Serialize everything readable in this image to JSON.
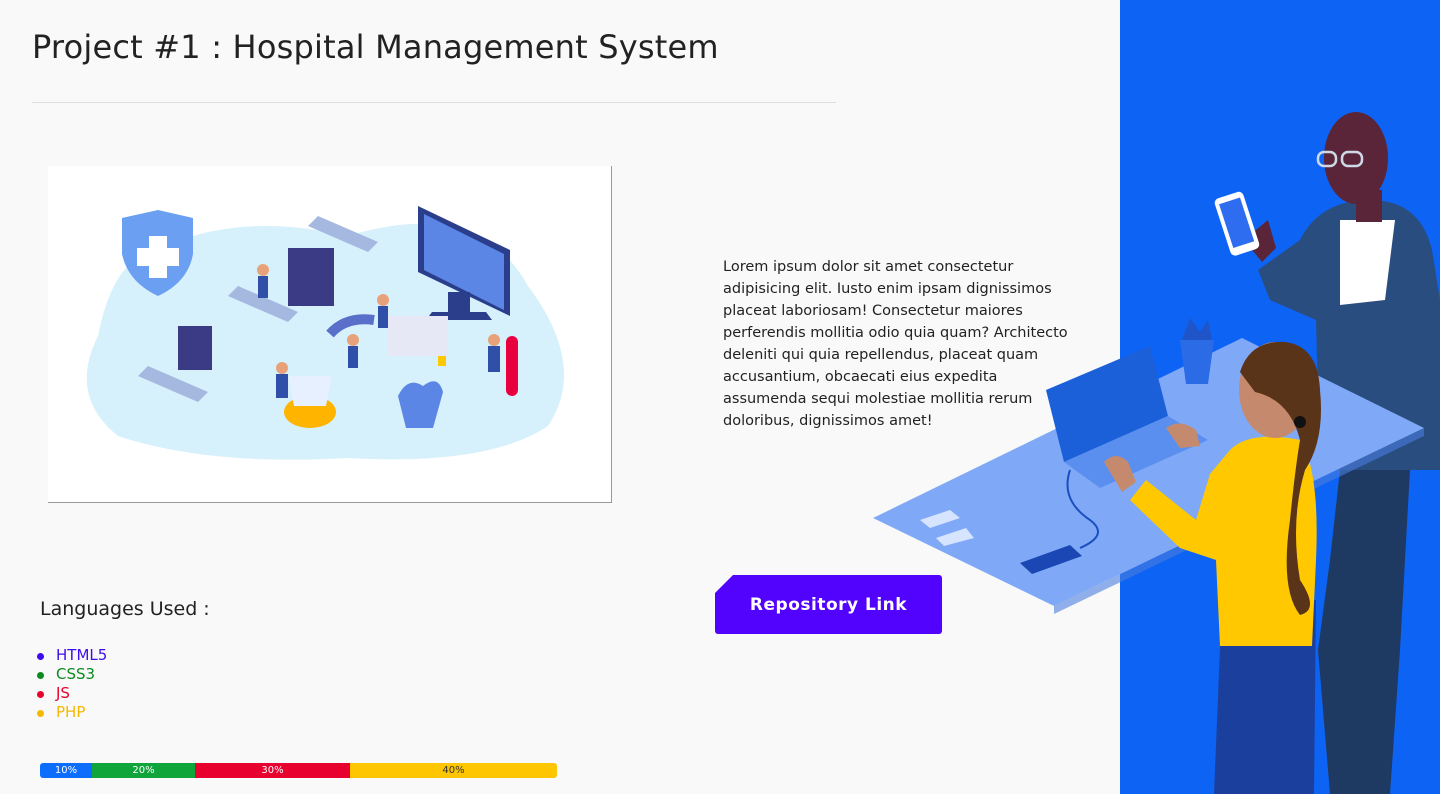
{
  "page": {
    "title": "Project #1 : Hospital Management System"
  },
  "description": "Lorem ipsum dolor sit amet consectetur adipisicing elit. Iusto enim ipsam dignissimos placeat laboriosam! Consectetur maiores perferendis mollitia odio quia quam? Architecto deleniti qui quia repellendus, placeat quam accusantium, obcaecati eius expedita assumenda sequi molestiae mollitia rerum doloribus, dignissimos amet!",
  "repository": {
    "button_label": "Repository Link"
  },
  "languages": {
    "heading": "Languages Used :",
    "items": [
      {
        "name": "HTML5",
        "color": "#3d0cf0",
        "percent_label": "10%",
        "fraction": 0.1,
        "bar_color": "#0d6efd"
      },
      {
        "name": "CSS3",
        "color": "#0b8a1e",
        "percent_label": "20%",
        "fraction": 0.2,
        "bar_color": "#0fa53a"
      },
      {
        "name": "JS",
        "color": "#e8002a",
        "percent_label": "30%",
        "fraction": 0.3,
        "bar_color": "#e8002e"
      },
      {
        "name": "PHP",
        "color": "#f5b800",
        "percent_label": "40%",
        "fraction": 0.4,
        "bar_color": "#fec600"
      }
    ]
  },
  "colors": {
    "accent": "#5203fd",
    "panel_blue": "#0d63f3"
  },
  "icons": {
    "hospital_shield": "shield-plus-icon"
  }
}
